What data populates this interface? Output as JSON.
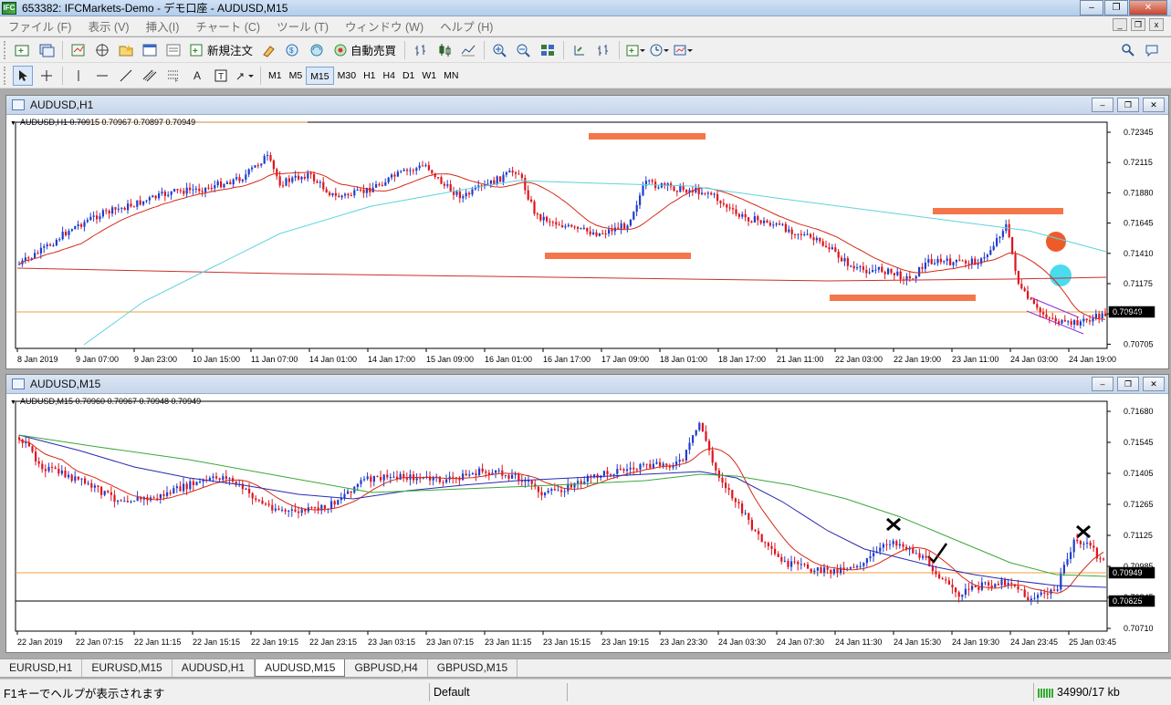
{
  "window": {
    "title": "653382: IFCMarkets-Demo - デモ口座 - AUDUSD,M15",
    "app_icon": "IFC"
  },
  "menu": [
    "ファイル (F)",
    "表示 (V)",
    "挿入(I)",
    "チャート (C)",
    "ツール (T)",
    "ウィンドウ (W)",
    "ヘルプ (H)"
  ],
  "toolbar": {
    "new_order": "新規注文",
    "auto_trading": "自動売買",
    "timeframes": [
      "M1",
      "M5",
      "M15",
      "M30",
      "H1",
      "H4",
      "D1",
      "W1",
      "MN"
    ],
    "active_timeframe": "M15"
  },
  "chart_h1": {
    "window_title": "AUDUSD,H1",
    "ohlc": "AUDUSD,H1  0.70915 0.70967 0.70897 0.70949",
    "y_ticks": [
      "0.72345",
      "0.72115",
      "0.71880",
      "0.71645",
      "0.71410",
      "0.71175",
      "0.70940",
      "0.70705"
    ],
    "current_price": "0.70949",
    "x_ticks": [
      "8 Jan 2019",
      "9 Jan 07:00",
      "9 Jan 23:00",
      "10 Jan 15:00",
      "11 Jan 07:00",
      "14 Jan 01:00",
      "14 Jan 17:00",
      "15 Jan 09:00",
      "16 Jan 01:00",
      "16 Jan 17:00",
      "17 Jan 09:00",
      "18 Jan 01:00",
      "18 Jan 17:00",
      "21 Jan 11:00",
      "22 Jan 03:00",
      "22 Jan 19:00",
      "23 Jan 11:00",
      "24 Jan 03:00",
      "24 Jan 19:00"
    ]
  },
  "chart_m15": {
    "window_title": "AUDUSD,M15",
    "ohlc": "AUDUSD,M15  0.70960 0.70967 0.70948 0.70949",
    "y_ticks": [
      "0.71680",
      "0.71545",
      "0.71405",
      "0.71265",
      "0.71125",
      "0.70985",
      "0.70845",
      "0.70710"
    ],
    "current_price": "0.70949",
    "line_price": "0.70825",
    "x_ticks": [
      "22 Jan 2019",
      "22 Jan 07:15",
      "22 Jan 11:15",
      "22 Jan 15:15",
      "22 Jan 19:15",
      "22 Jan 23:15",
      "23 Jan 03:15",
      "23 Jan 07:15",
      "23 Jan 11:15",
      "23 Jan 15:15",
      "23 Jan 19:15",
      "23 Jan 23:30",
      "24 Jan 03:30",
      "24 Jan 07:30",
      "24 Jan 11:30",
      "24 Jan 15:30",
      "24 Jan 19:30",
      "24 Jan 23:45",
      "25 Jan 03:45"
    ]
  },
  "tabs": [
    "EURUSD,H1",
    "EURUSD,M15",
    "AUDUSD,H1",
    "AUDUSD,M15",
    "GBPUSD,H4",
    "GBPUSD,M15"
  ],
  "active_tab": "AUDUSD,M15",
  "status": {
    "help": "F1キーでヘルプが表示されます",
    "profile": "Default",
    "traffic": "34990/17 kb"
  },
  "colors": {
    "bull": "#1f3ecf",
    "bear": "#e0141e",
    "ma_fast": "#d42a16",
    "ma_slow_h1": "#5fd3dc",
    "ma_long_h1": "#c9302c",
    "ma_blue": "#2a2ab0",
    "ma_green": "#3aa83a",
    "orange_marker": "#f4764a",
    "price_line": "#f0a040"
  }
}
